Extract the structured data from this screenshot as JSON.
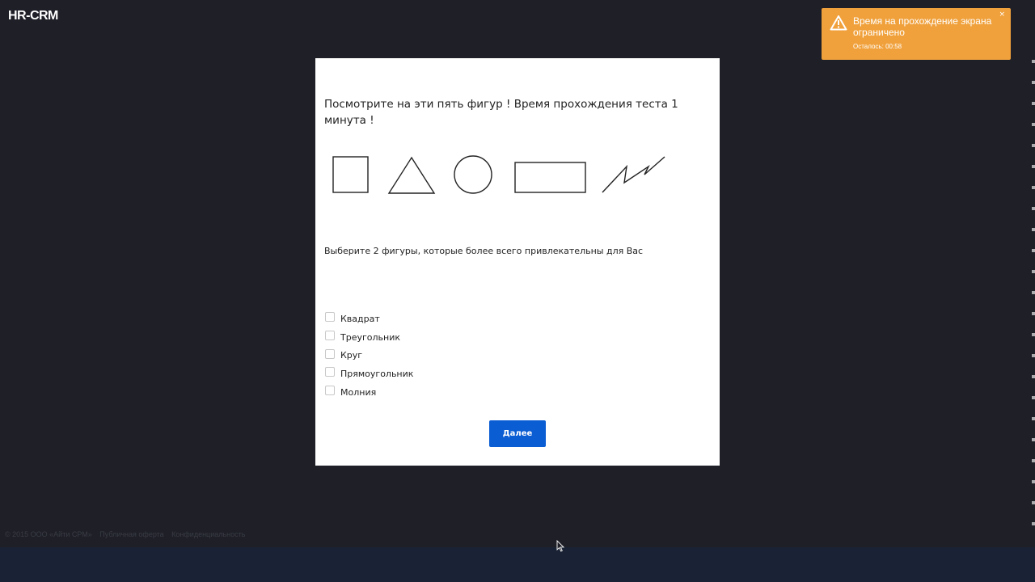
{
  "app": {
    "logo": "HR-CRM"
  },
  "toast": {
    "title": "Время на прохождение экрана ограничено",
    "remaining": "Осталось: 00:58",
    "close": "×",
    "color": "#f0a13c",
    "icon": "warning-icon"
  },
  "test": {
    "question": "Посмотрите на эти пять фигур ! Время прохождения теста 1 минута !",
    "shapes": [
      "square-icon",
      "triangle-icon",
      "circle-icon",
      "rectangle-icon",
      "zigzag-icon"
    ],
    "instruction": "Выберите 2 фигуры, которые более всего привлекательны для Вас",
    "options": [
      {
        "label": "Квадрат",
        "checked": false
      },
      {
        "label": "Треугольник",
        "checked": false
      },
      {
        "label": "Круг",
        "checked": false
      },
      {
        "label": "Прямоугольник",
        "checked": false
      },
      {
        "label": "Молния",
        "checked": false
      }
    ],
    "next_label": "Далее",
    "accent": "#0b5dd4"
  },
  "footer": {
    "copyright": "© 2015 ООО «Айти СРМ»",
    "offer": "Публичная оферта",
    "privacy": "Конфиденциальность"
  }
}
